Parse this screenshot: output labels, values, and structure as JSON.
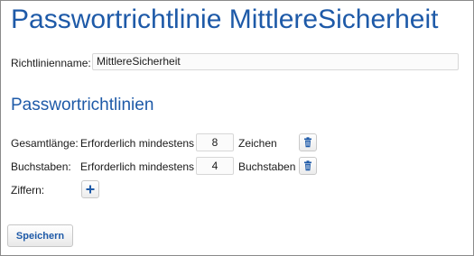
{
  "page": {
    "title": "Passwortrichtlinie MittlereSicherheit"
  },
  "policy_name": {
    "label": "Richtlinienname:",
    "value": "MittlereSicherheit"
  },
  "section": {
    "title": "Passwortrichtlinien"
  },
  "rules": [
    {
      "label": "Gesamtlänge:",
      "requirement": "Erforderlich mindestens",
      "value": "8",
      "unit": "Zeichen",
      "action_icon": "trash-icon"
    },
    {
      "label": "Buchstaben:",
      "requirement": "Erforderlich mindestens",
      "value": "4",
      "unit": "Buchstaben",
      "action_icon": "trash-icon"
    },
    {
      "label": "Ziffern:",
      "action_icon": "plus-icon"
    }
  ],
  "actions": {
    "save_label": "Speichern"
  },
  "colors": {
    "accent": "#1e5aa8",
    "border": "#8a8a8a"
  }
}
